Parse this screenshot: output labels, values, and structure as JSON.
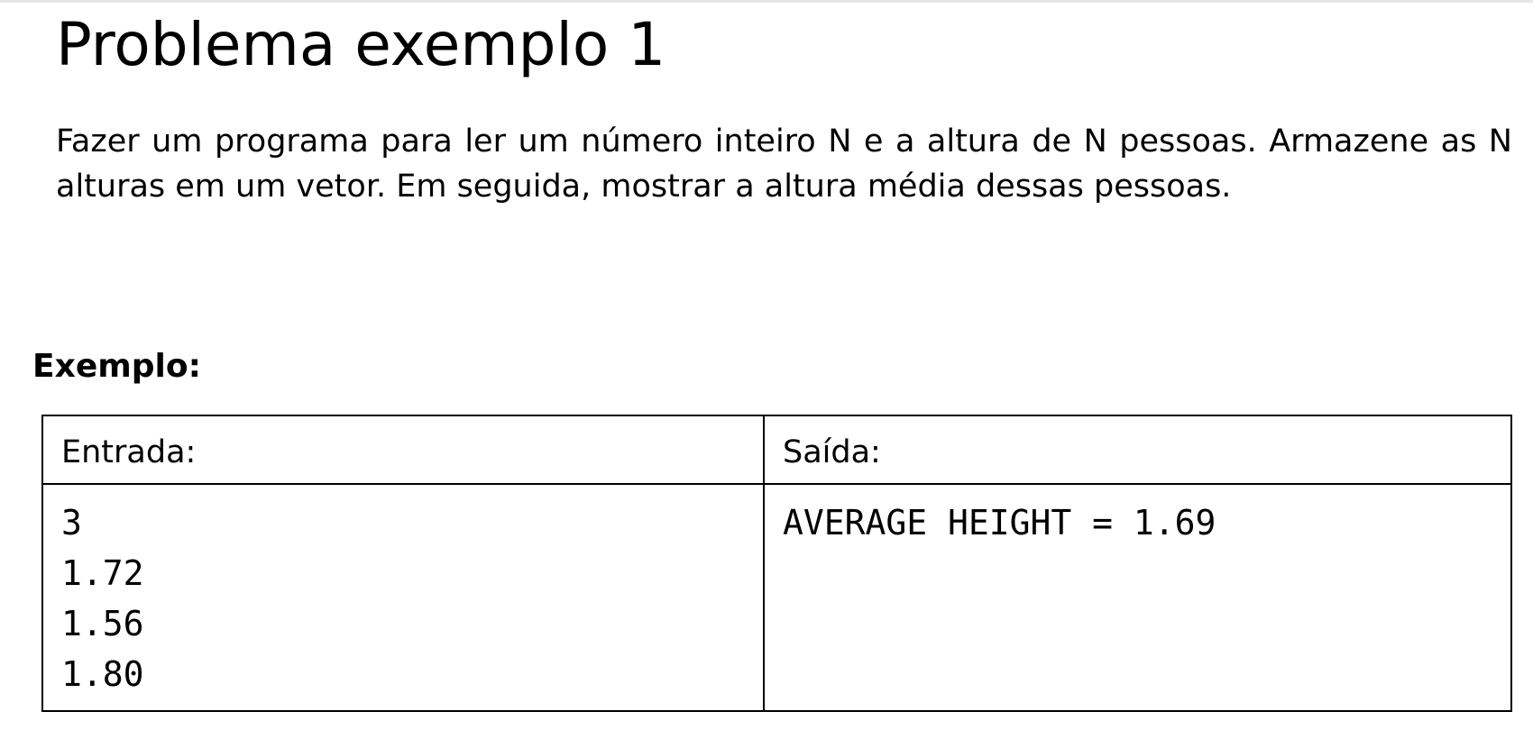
{
  "slide": {
    "title": "Problema exemplo 1",
    "statement": "Fazer um programa para ler um número inteiro N e a altura de N pessoas. Armazene as N alturas em um vetor. Em seguida, mostrar a altura média dessas pessoas.",
    "example_label": "Exemplo:"
  },
  "example_table": {
    "input_header": "Entrada:",
    "output_header": "Saída:",
    "input_lines": [
      "3",
      "1.72",
      "1.56",
      "1.80"
    ],
    "output_lines": [
      "AVERAGE HEIGHT = 1.69"
    ]
  }
}
